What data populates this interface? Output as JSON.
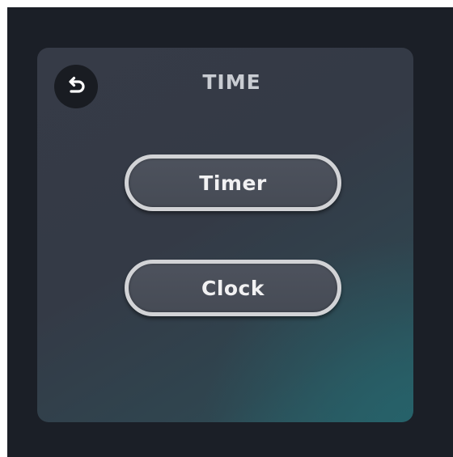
{
  "screen": {
    "title": "TIME",
    "back_icon": "undo-arrow-icon"
  },
  "menu": {
    "items": [
      {
        "label": "Timer"
      },
      {
        "label": "Clock"
      }
    ]
  },
  "colors": {
    "background": "#1b1f27",
    "panel": "#363b47",
    "panel_accent": "#2a5a62",
    "button_border": "#d2d3d6",
    "button_fill": "#4a4f59",
    "text": "#f1f1f2"
  }
}
